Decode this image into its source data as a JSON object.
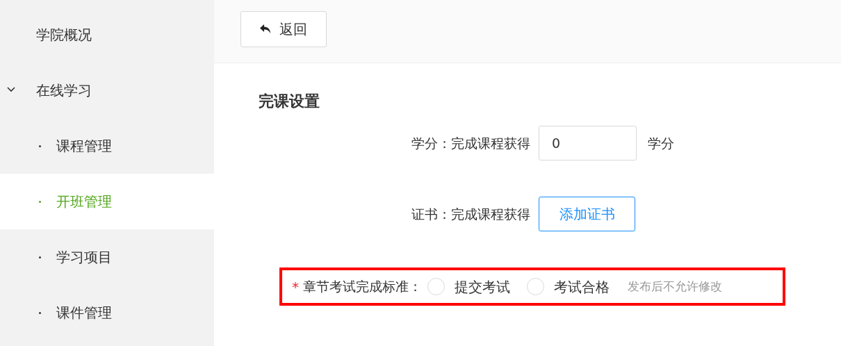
{
  "sidebar": {
    "items": [
      {
        "label": "学院概况",
        "selected": false
      },
      {
        "label": "在线学习",
        "expanded": true,
        "selected": false,
        "children": [
          {
            "label": "课程管理",
            "selected": false
          },
          {
            "label": "开班管理",
            "selected": true
          },
          {
            "label": "学习项目",
            "selected": false
          },
          {
            "label": "课件管理",
            "selected": false
          }
        ]
      }
    ]
  },
  "toolbar": {
    "back_button": "返回"
  },
  "section": {
    "title": "完课设置",
    "credit": {
      "label": "学分：完成课程获得",
      "value": "0",
      "unit": "学分"
    },
    "certificate": {
      "label": "证书：完成课程获得",
      "button": "添加证书"
    },
    "exam_standard": {
      "required_mark": "*",
      "label": "章节考试完成标准：",
      "highlighted": true,
      "options": [
        {
          "label": "提交考试",
          "selected": false
        },
        {
          "label": "考试合格",
          "selected": false
        }
      ],
      "note": "发布后不允许修改"
    }
  }
}
